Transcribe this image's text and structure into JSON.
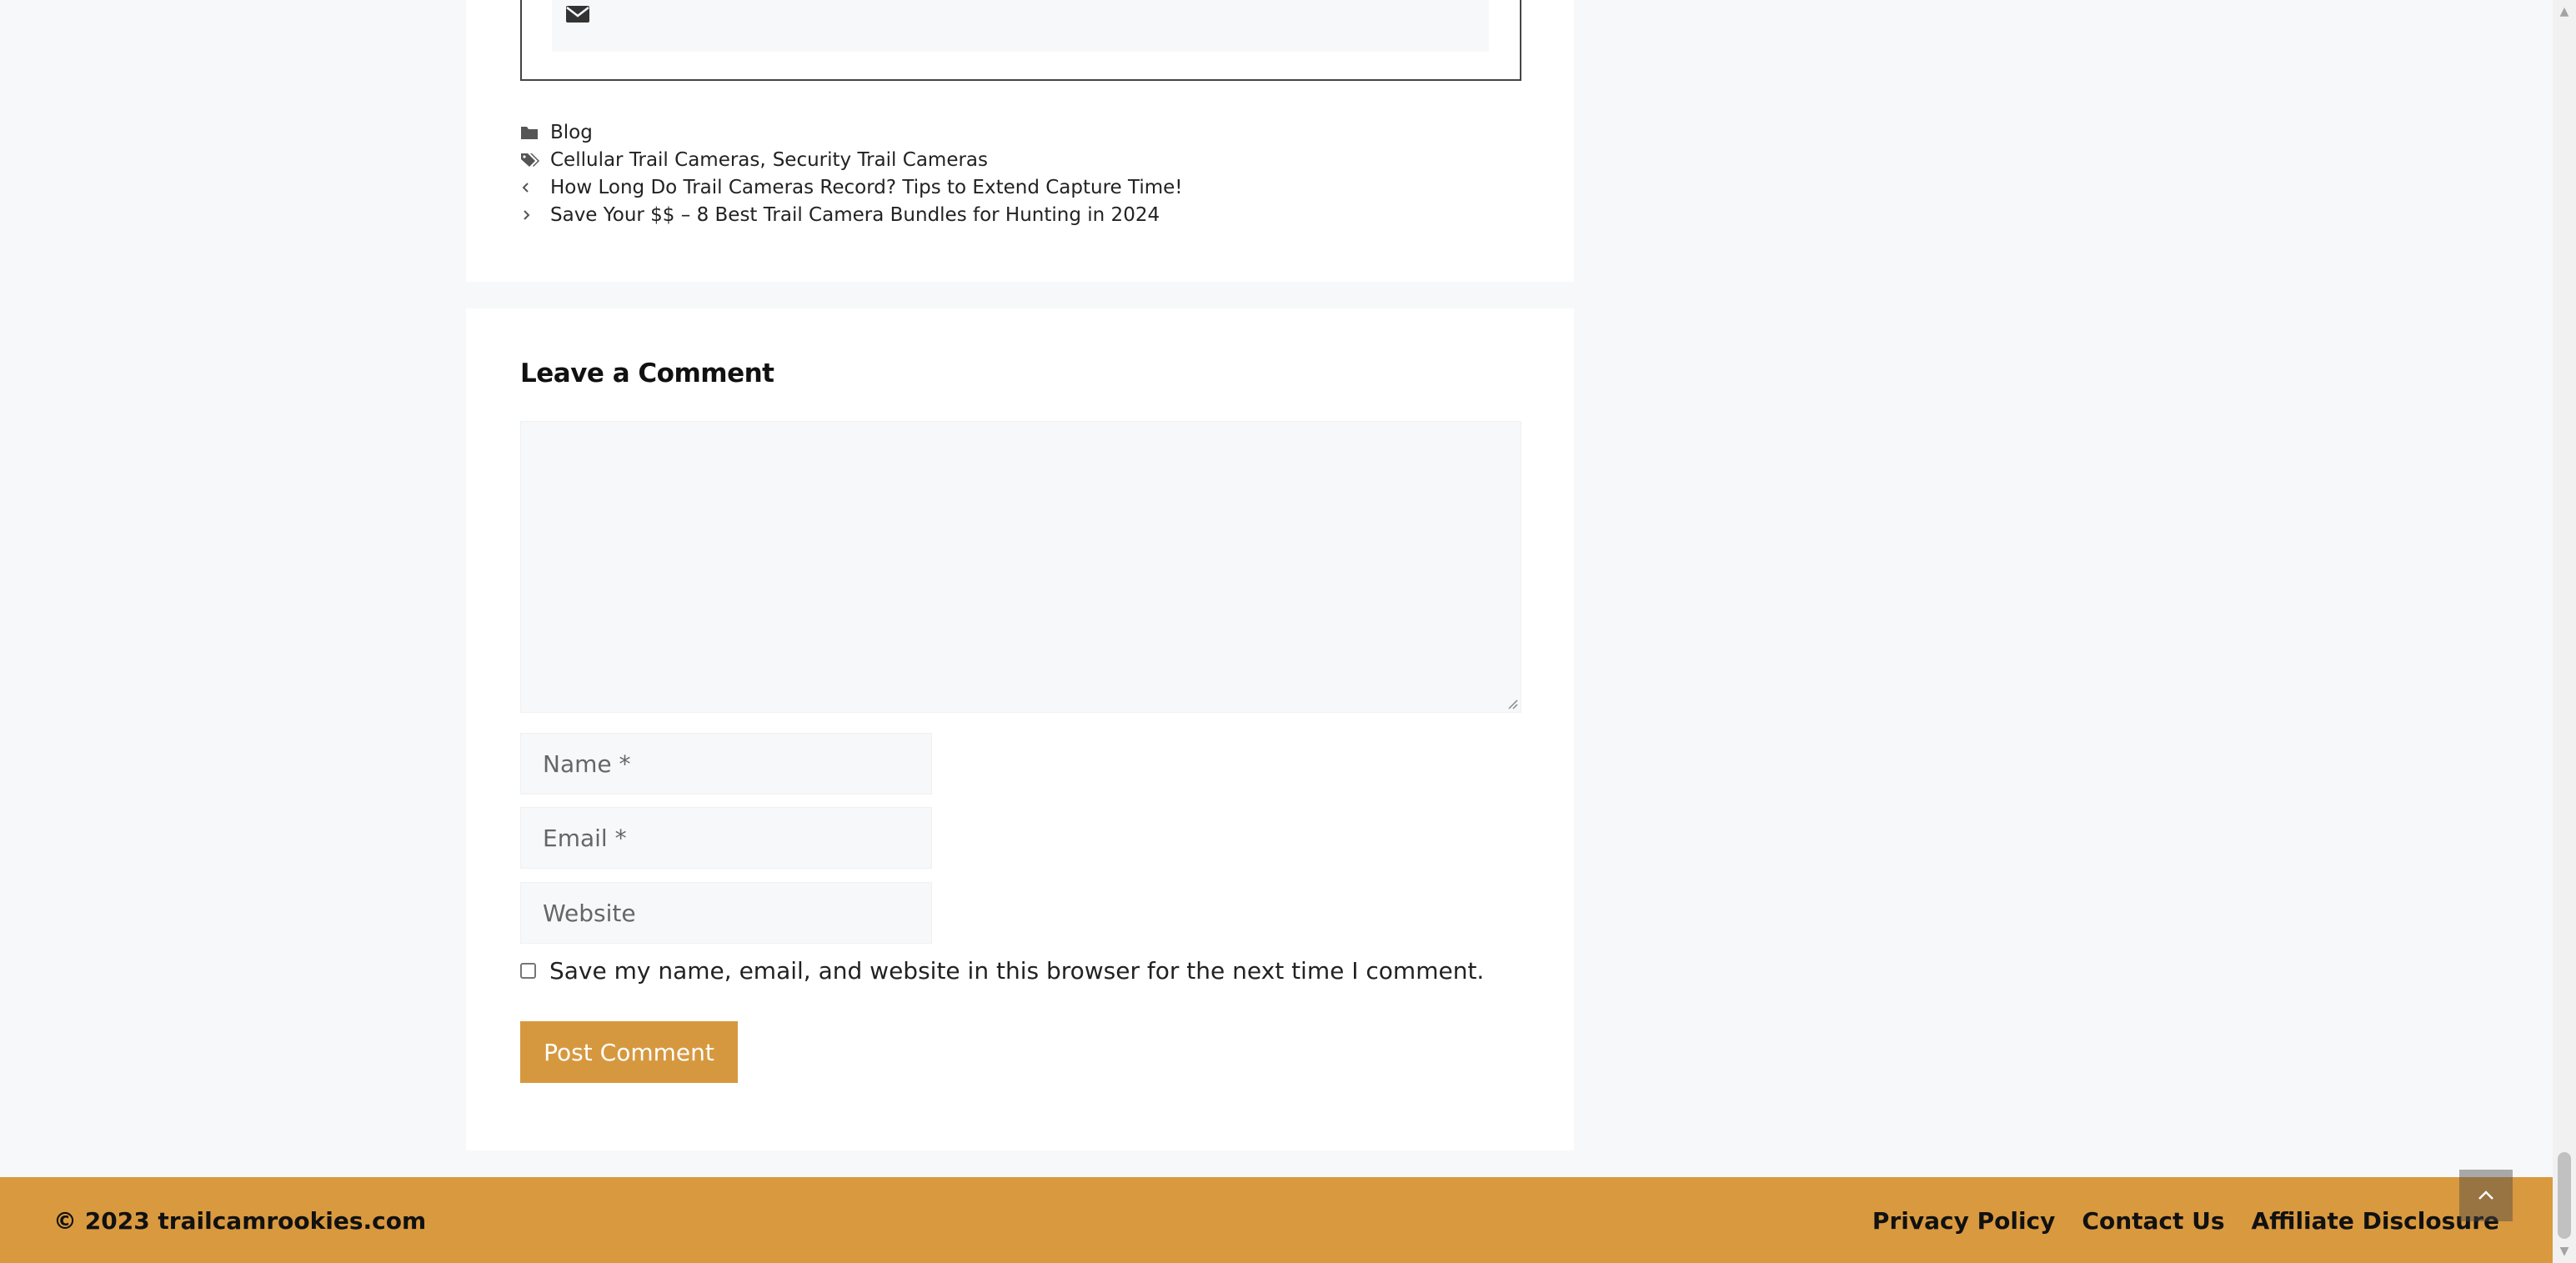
{
  "post_meta": {
    "category": "Blog",
    "tag_1": "Cellular Trail Cameras",
    "tag_separator": ",",
    "tag_2": "Security Trail Cameras",
    "prev_post": "How Long Do Trail Cameras Record? Tips to Extend Capture Time!",
    "next_post": "Save Your $$ – 8 Best Trail Camera Bundles for Hunting in 2024"
  },
  "icons": {
    "author_contact": "envelope-icon",
    "category": "folder-icon",
    "tags": "tags-icon",
    "prev": "chevron-left-icon",
    "next": "chevron-right-icon",
    "back_to_top": "chevron-up-icon"
  },
  "comment_form": {
    "title": "Leave a Comment",
    "name_placeholder": "Name *",
    "email_placeholder": "Email *",
    "website_placeholder": "Website",
    "consent_label": "Save my name, email, and website in this browser for the next time I comment.",
    "consent_checked": false,
    "submit_label": "Post Comment"
  },
  "footer": {
    "copyright": "© 2023 trailcamrookies.com",
    "links": [
      "Privacy Policy",
      "Contact Us",
      "Affiliate Disclosure"
    ]
  },
  "colors": {
    "accent": "#d6983f",
    "footer_bg": "#d9993f",
    "page_bg": "#f7f8f9",
    "card_bg": "#ffffff",
    "field_bg": "#f7f8f9"
  }
}
